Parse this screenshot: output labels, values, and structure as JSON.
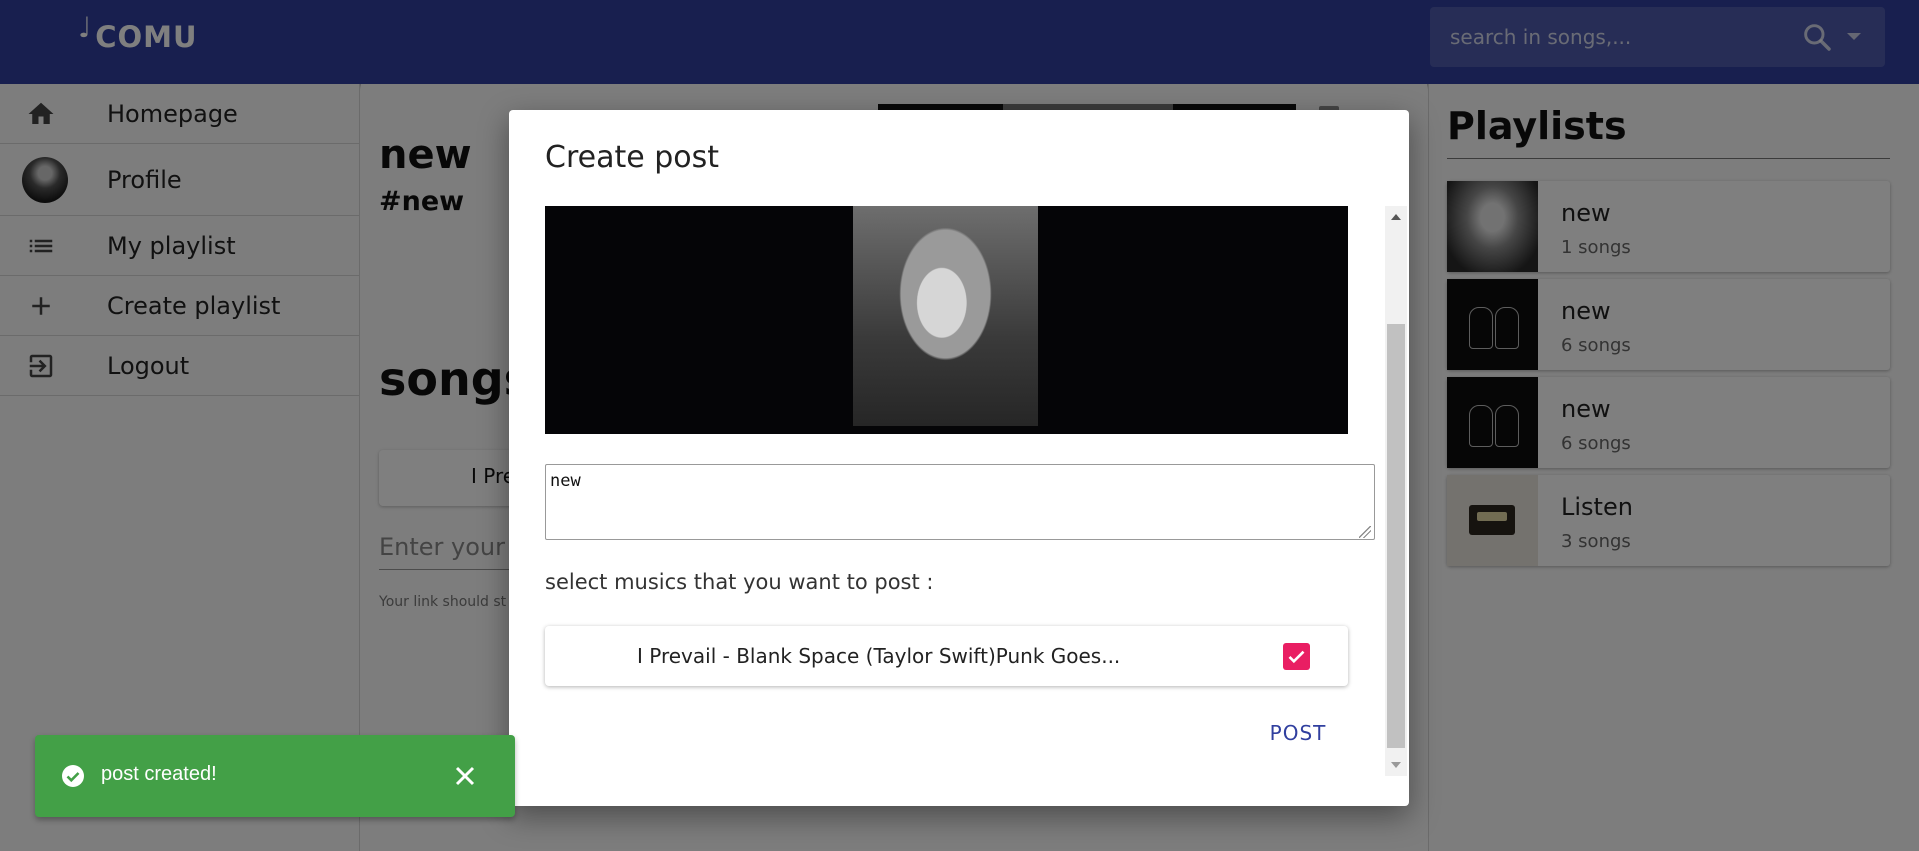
{
  "app": {
    "brand": "COMU"
  },
  "search": {
    "placeholder": "search in songs,..."
  },
  "sidebar": {
    "items": [
      {
        "label": "Homepage"
      },
      {
        "label": "Profile"
      },
      {
        "label": "My playlist"
      },
      {
        "label": "Create playlist"
      },
      {
        "label": "Logout"
      }
    ]
  },
  "main": {
    "playlist_title": "new",
    "playlist_tag": "#new",
    "songs_heading": "songs",
    "song_item": "I Pre",
    "link_placeholder": "Enter your s",
    "link_help": "Your link should st"
  },
  "playlists": {
    "heading": "Playlists",
    "items": [
      {
        "name": "new",
        "count": "1 songs",
        "thumb": "face-photo"
      },
      {
        "name": "new",
        "count": "6 songs",
        "thumb": "hands-art"
      },
      {
        "name": "new",
        "count": "6 songs",
        "thumb": "hands-art"
      },
      {
        "name": "Listen",
        "count": "3 songs",
        "thumb": "cassette"
      }
    ]
  },
  "modal": {
    "title": "Create post",
    "caption": "new",
    "select_label": "select musics that you want to post :",
    "music_item": "I Prevail - Blank Space (Taylor Swift)Punk Goes...",
    "music_checked": true,
    "post_button": "POST"
  },
  "toast": {
    "message": "post created!"
  },
  "colors": {
    "appbar": "#303f9f",
    "accent": "#e91e63",
    "success": "#43a047",
    "primary_text_button": "#303f9f"
  }
}
